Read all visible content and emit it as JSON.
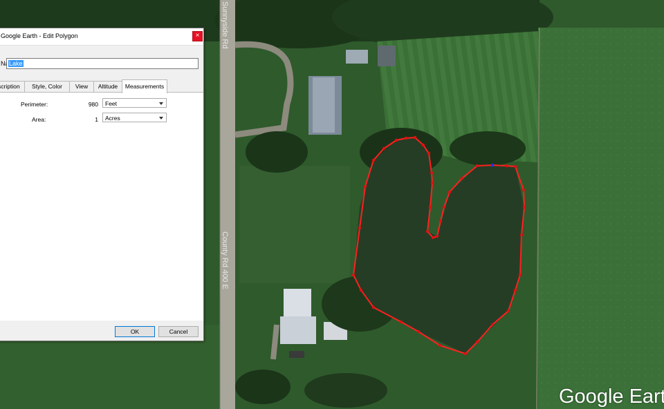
{
  "map": {
    "road_labels": [
      "Sunnyside Rd",
      "County Rd 400 E"
    ],
    "watermark": "Google Earth",
    "polygon_color": "#ff2020",
    "polygon_point_color": "#e01010",
    "selected_point_color": "#2233ff"
  },
  "dialog": {
    "title": "Google Earth - Edit Polygon",
    "close_glyph": "×",
    "name_label": "Name:",
    "name_value": "Lake",
    "tabs": [
      {
        "label": "Description",
        "active": false
      },
      {
        "label": "Style, Color",
        "active": false
      },
      {
        "label": "View",
        "active": false
      },
      {
        "label": "Altitude",
        "active": false
      },
      {
        "label": "Measurements",
        "active": true
      }
    ],
    "measurements": {
      "perimeter_label": "Perimeter:",
      "perimeter_value": "980",
      "perimeter_unit": "Feet",
      "area_label": "Area:",
      "area_value": "1",
      "area_unit": "Acres"
    },
    "ok_label": "OK",
    "cancel_label": "Cancel"
  }
}
